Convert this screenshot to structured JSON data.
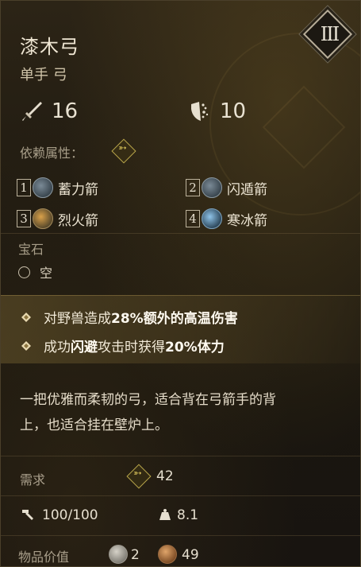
{
  "item": {
    "name": "漆木弓",
    "type": "单手 弓",
    "tier": "III"
  },
  "stats": {
    "damage": "16",
    "stagger": "10"
  },
  "attributes": {
    "label": "依赖属性："
  },
  "skills": [
    {
      "num": "1",
      "label": "蓄力箭"
    },
    {
      "num": "2",
      "label": "闪遁箭"
    },
    {
      "num": "3",
      "label": "烈火箭"
    },
    {
      "num": "4",
      "label": "寒冰箭"
    }
  ],
  "gem": {
    "label": "宝石",
    "slot": "空"
  },
  "perks": [
    {
      "pre": "对野兽造成",
      "bold": "28%额外的高温伤害",
      "post": "",
      "pre2": ""
    },
    {
      "pre": "成功",
      "bold": "闪避",
      "post": "攻击时获得",
      "bold2": "20%体力"
    }
  ],
  "description": {
    "line1": "一把优雅而柔韧的弓，适合背在弓箭手的背",
    "line2": "上，也适合挂在壁炉上。"
  },
  "requirement": {
    "label": "需求",
    "value": "42"
  },
  "durability": {
    "value": "100/100",
    "weight": "8.1"
  },
  "value": {
    "label": "物品价值",
    "silver": "2",
    "copper": "49"
  },
  "colors": {
    "accent_gold": "#d9c35a",
    "background": "#1f1a11",
    "text": "#e8e0cf"
  }
}
